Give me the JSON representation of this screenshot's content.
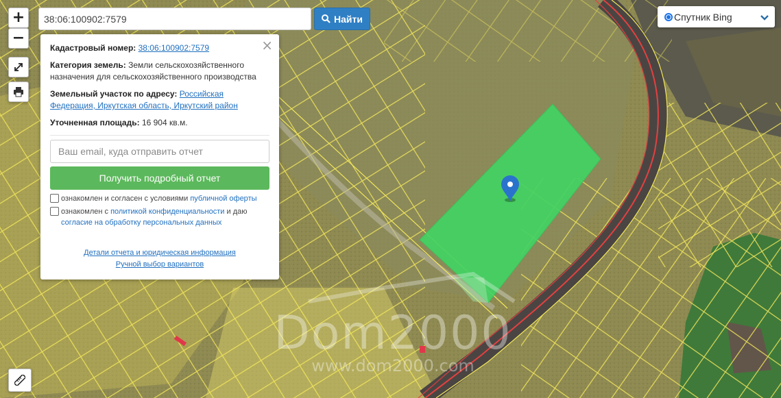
{
  "search": {
    "value": "38:06:100902:7579",
    "button_label": "Найти"
  },
  "layer": {
    "selected": "Спутник Bing"
  },
  "controls": {
    "zoom_in": "+",
    "zoom_out": "−"
  },
  "info": {
    "cadastral_label": "Кадастровый номер:",
    "cadastral_number": "38:06:100902:7579",
    "category_label": "Категория земель:",
    "category_value": "Земли сельскохозяйственного назначения для сельскохозяйственного производства",
    "address_label": "Земельный участок по адресу:",
    "address_value": "Российская Федерация, Иркутская область, Иркутский район",
    "area_label": "Уточненная площадь:",
    "area_value": "16 904",
    "area_unit": "кв.м.",
    "close": "×"
  },
  "report": {
    "email_placeholder": "Ваш email, куда отправить отчет",
    "button_label": "Получить подробный отчет",
    "offer_text": "ознакомлен и согласен с условиями",
    "offer_link": "публичной оферты",
    "privacy_text_1": "ознакомлен с",
    "privacy_link": "политикой конфиденциальности",
    "privacy_text_2": "и даю",
    "consent_link": "согласие на обработку персональных данных",
    "details_link": "Детали отчета и юридическая информация",
    "manual_link": "Ручной выбор вариантов"
  },
  "watermark": {
    "brand": "Dom2000",
    "url": "www.dom2000.com"
  },
  "colors": {
    "map_base": "#8f8a52",
    "parcel_outline": "#f2e65a",
    "parcel_highlight": "#43d364",
    "road": "#4a4542",
    "road_line": "#e54040",
    "marker": "#2a73cc",
    "forest": "#3f7a3a",
    "button_primary": "#2f7fc4",
    "button_success": "#5cb85c"
  },
  "icons": [
    "search-icon",
    "expand-icon",
    "print-icon",
    "ruler-icon",
    "chevron-down-icon",
    "map-marker-icon",
    "close-icon"
  ]
}
